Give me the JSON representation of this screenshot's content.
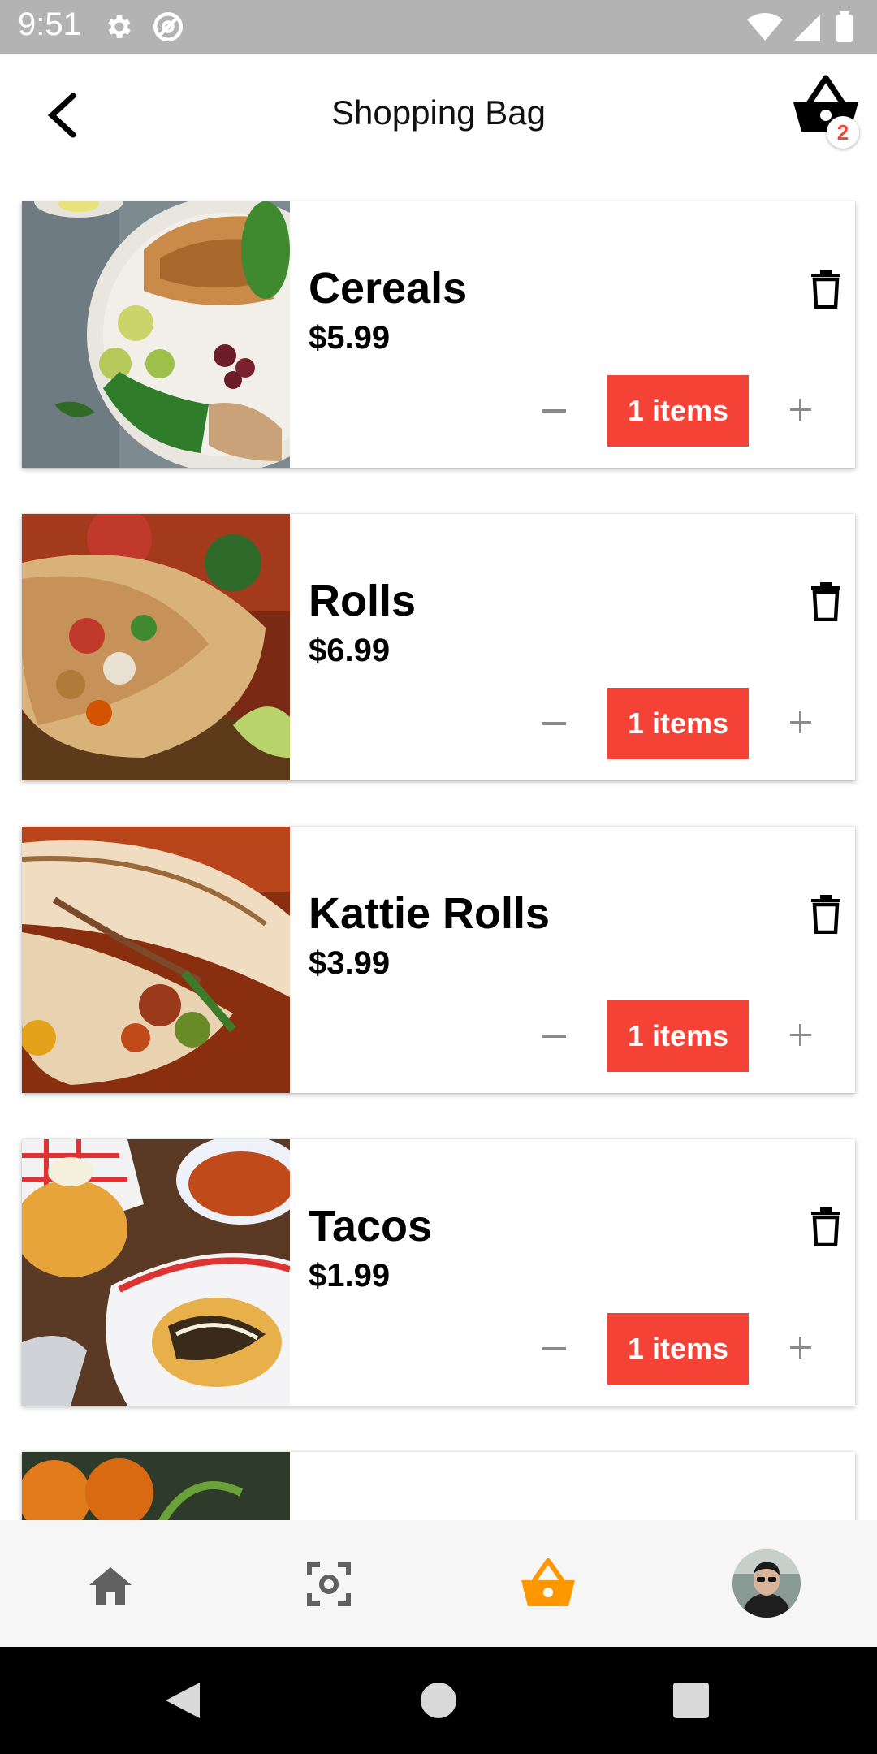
{
  "status_bar": {
    "time": "9:51",
    "icons": [
      "gear-icon",
      "at-icon",
      "wifi-icon",
      "signal-icon",
      "battery-icon"
    ]
  },
  "header": {
    "title": "Shopping Bag",
    "cart_badge": "2",
    "back_icon": "chevron-left-icon",
    "cart_icon": "basket-icon"
  },
  "cart": {
    "items": [
      {
        "name": "Cereals",
        "price": "$5.99",
        "quantity_label": "1 items",
        "quantity": 1,
        "image": "salad-bowl"
      },
      {
        "name": "Rolls",
        "price": "$6.99",
        "quantity_label": "1 items",
        "quantity": 1,
        "image": "burrito"
      },
      {
        "name": "Kattie Rolls",
        "price": "$3.99",
        "quantity_label": "1 items",
        "quantity": 1,
        "image": "wrap"
      },
      {
        "name": "Tacos",
        "price": "$1.99",
        "quantity_label": "1 items",
        "quantity": 1,
        "image": "fries-baskets"
      }
    ],
    "partial_item_image": "oranges"
  },
  "bottom_nav": {
    "items": [
      "home-icon",
      "scan-icon",
      "basket-icon",
      "avatar"
    ],
    "active": "basket-icon",
    "active_color": "#ff9800",
    "inactive_color": "#616161"
  },
  "colors": {
    "accent": "#f44336",
    "status_bar": "#b3b3b3"
  }
}
